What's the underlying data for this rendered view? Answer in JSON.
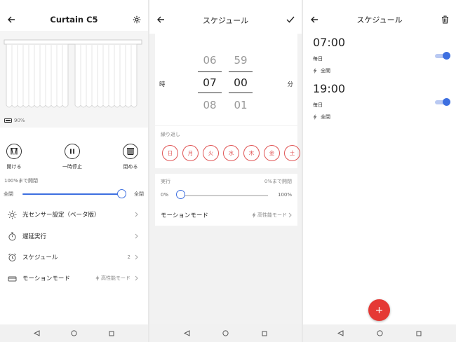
{
  "accent_color": "#3d6fe0",
  "day_color": "#e05555",
  "fab_color": "#e53935",
  "device_screen": {
    "title": "Curtain C5",
    "battery": "90%",
    "open_label": "開ける",
    "pause_label": "一時停止",
    "close_label": "閉める",
    "slider_note": "100%まで開閉",
    "slider_min_label": "全閉",
    "slider_max_label": "全閉",
    "slider_value_percent": 100,
    "menu": [
      {
        "label": "光センサー設定（ベータ版）",
        "value": "",
        "icon": "sun-sensor-icon"
      },
      {
        "label": "遅延実行",
        "value": "",
        "icon": "stopwatch-icon"
      },
      {
        "label": "スケジュール",
        "value": "2",
        "icon": "alarm-clock-icon"
      },
      {
        "label": "モーションモード",
        "value": "高性能モード",
        "icon": "motion-mode-icon"
      }
    ]
  },
  "edit_screen": {
    "title": "スケジュール",
    "hour_label": "時",
    "minute_label": "分",
    "hours": [
      "06",
      "07",
      "08"
    ],
    "minutes": [
      "59",
      "00",
      "01"
    ],
    "repeat_label": "繰り返し",
    "days": [
      "日",
      "月",
      "火",
      "水",
      "木",
      "金",
      "土"
    ],
    "execute_label": "実行",
    "execute_value": "0%まで開閉",
    "range_min": "0%",
    "range_max": "100%",
    "execute_percent": 0,
    "motion_label": "モーションモード",
    "motion_value": "高性能モード"
  },
  "list_screen": {
    "title": "スケジュール",
    "schedules": [
      {
        "time": "07:00",
        "repeat": "毎日",
        "action": "全開",
        "enabled": true
      },
      {
        "time": "19:00",
        "repeat": "毎日",
        "action": "全閉",
        "enabled": true
      }
    ],
    "fab_label": "+"
  }
}
